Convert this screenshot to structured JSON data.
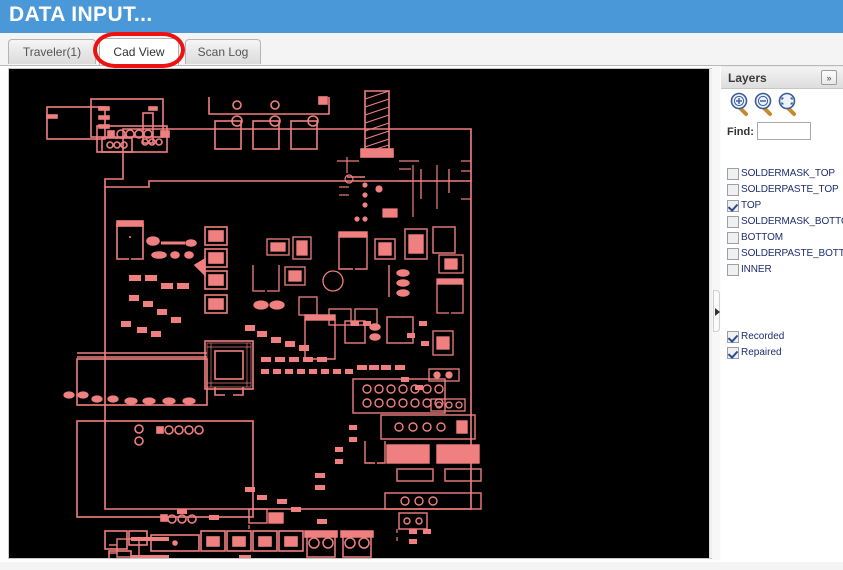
{
  "window": {
    "title": "DATA INPUT...",
    "header_color": "#4a98d8"
  },
  "tabs": [
    {
      "label": "Traveler(1)",
      "active": false
    },
    {
      "label": "Cad View",
      "active": true
    },
    {
      "label": "Scan Log",
      "active": false
    }
  ],
  "annotation": {
    "type": "red-oval-highlight",
    "target": "Cad View",
    "color": "#ee1111"
  },
  "cad_view": {
    "background_color": "#000000",
    "trace_color": "#f08080",
    "board_outline_color": "#f08080",
    "description": "PCB CAD layout top layer component outlines"
  },
  "layers_panel": {
    "header_title": "Layers",
    "expand_button_label": "»",
    "zoom_tools": [
      {
        "name": "zoom-in",
        "symbol": "+"
      },
      {
        "name": "zoom-out",
        "symbol": "−"
      },
      {
        "name": "zoom-fit",
        "symbol": "[ ]"
      }
    ],
    "find": {
      "label": "Find:",
      "value": "",
      "placeholder": ""
    },
    "layers": [
      {
        "label": "SOLDERMASK_TOP",
        "checked": false
      },
      {
        "label": "SOLDERPASTE_TOP",
        "checked": false
      },
      {
        "label": "TOP",
        "checked": true
      },
      {
        "label": "SOLDERMASK_BOTTOM",
        "checked": false
      },
      {
        "label": "BOTTOM",
        "checked": false
      },
      {
        "label": "SOLDERPASTE_BOTTOM",
        "checked": false
      },
      {
        "label": "INNER",
        "checked": false
      }
    ],
    "flags": [
      {
        "label": "Recorded",
        "checked": true
      },
      {
        "label": "Repaired",
        "checked": true
      }
    ]
  }
}
